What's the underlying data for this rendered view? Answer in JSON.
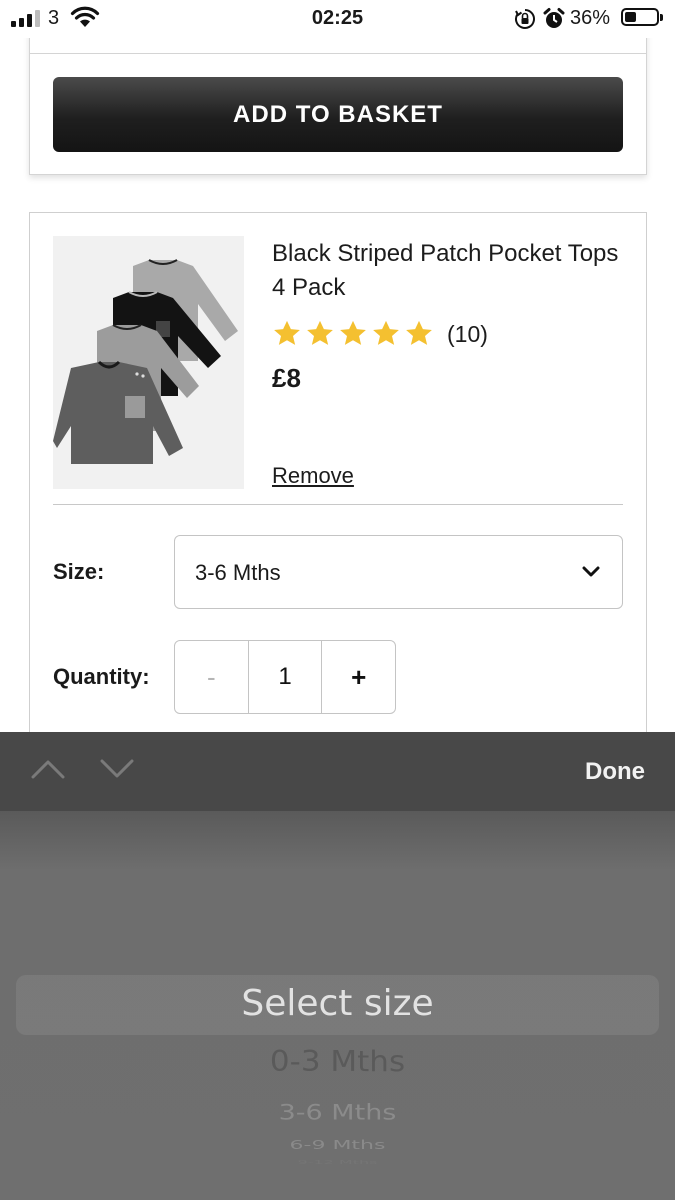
{
  "status_bar": {
    "carrier": "3",
    "time": "02:25",
    "battery_percent": "36%",
    "battery_level": 0.36,
    "icons": [
      "signal-icon",
      "wifi-icon",
      "orientation-lock-icon",
      "alarm-icon",
      "battery-icon"
    ]
  },
  "cart": {
    "add_to_basket_label": "ADD TO BASKET"
  },
  "product": {
    "title": "Black Striped Patch Pocket Tops 4 Pack",
    "rating": 5,
    "rating_count": "(10)",
    "price": "£8",
    "remove_label": "Remove",
    "size_label": "Size:",
    "size_value": "3-6 Mths",
    "quantity_label": "Quantity:",
    "quantity_minus": "-",
    "quantity_value": "1",
    "quantity_plus": "+"
  },
  "picker": {
    "done_label": "Done",
    "options": [
      "Select size",
      "0-3 Mths",
      "3-6 Mths",
      "6-9 Mths",
      "9-12 Mths"
    ]
  },
  "colors": {
    "star": "#f4c030",
    "button_dark": "#1f1f1f",
    "toolbar": "#484848",
    "picker_bg": "#6e6e6e"
  }
}
